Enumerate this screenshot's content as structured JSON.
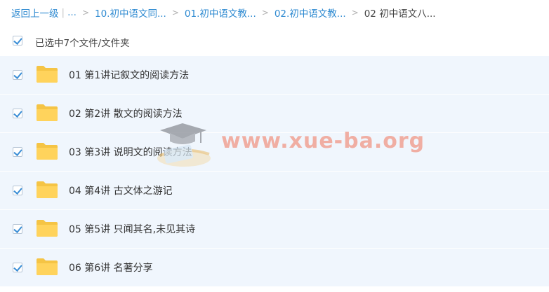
{
  "breadcrumb": {
    "back": "返回上一级",
    "ellipsis": "...",
    "items": [
      "10.初中语文同...",
      "01.初中语文教...",
      "02.初中语文教..."
    ],
    "current": "02 初中语文八..."
  },
  "selection": {
    "text": "已选中7个文件/文件夹",
    "checked": true
  },
  "files": [
    {
      "name": "01 第1讲记叙文的阅读方法",
      "checked": true
    },
    {
      "name": "02 第2讲 散文的阅读方法",
      "checked": true
    },
    {
      "name": "03 第3讲 说明文的阅读方法",
      "checked": true
    },
    {
      "name": "04 第4讲 古文体之游记",
      "checked": true
    },
    {
      "name": "05 第5讲 只闻其名,未见其诗",
      "checked": true
    },
    {
      "name": "06 第6讲 名著分享",
      "checked": true
    }
  ],
  "watermark": {
    "text": "www.xue-ba.org"
  },
  "colors": {
    "link": "#2e8ad1",
    "row_bg": "#f0f6fd",
    "folder": "#ffd35c",
    "check": "#3b8ed6"
  },
  "icons": {
    "folder": "folder-icon",
    "check": "checkbox-checked-icon",
    "watermark_logo": "graduation-cap-icon"
  }
}
